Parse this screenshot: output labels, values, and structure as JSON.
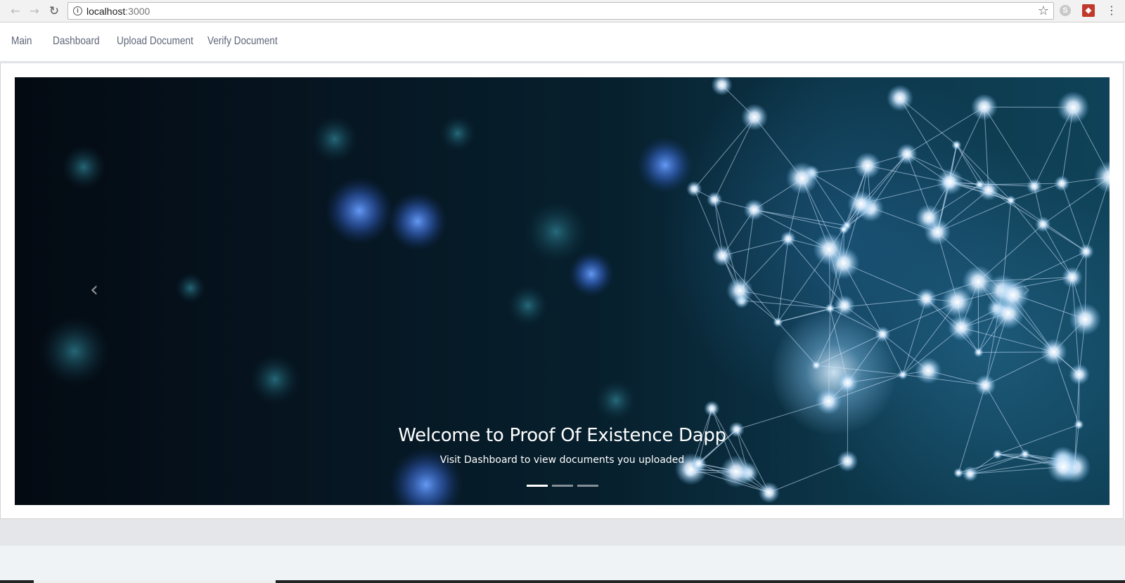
{
  "browser": {
    "back_icon": "arrow-left-icon",
    "forward_icon": "arrow-right-icon",
    "reload_icon": "reload-icon",
    "url_host": "localhost",
    "url_port": ":3000",
    "bookmark_icon": "star-icon",
    "menu_icon": "kebab-menu-icon"
  },
  "navbar": {
    "links": [
      {
        "label": "Main"
      },
      {
        "label": "Dashboard"
      },
      {
        "label": "Upload Document"
      },
      {
        "label": "Verify Document"
      }
    ]
  },
  "carousel": {
    "title": "Welcome to Proof Of Existence Dapp",
    "subtitle": "Visit Dashboard to view documents you uploaded",
    "prev_glyph": "‹",
    "next_glyph": "›",
    "slide_count": 3,
    "active_slide": 1
  },
  "colors": {
    "nav_text": "#5d6778",
    "carousel_bg": "#061622",
    "accent_glow": "#5aa8d8"
  }
}
